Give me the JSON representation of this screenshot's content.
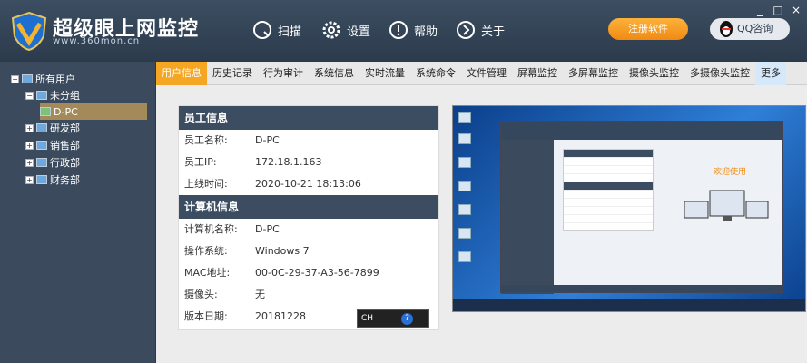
{
  "app": {
    "brand": "超级眼上网监控",
    "url": "www.360mon.cn",
    "nav": [
      {
        "label": "扫描",
        "icon": "search-icon"
      },
      {
        "label": "设置",
        "icon": "gear-icon"
      },
      {
        "label": "帮助",
        "icon": "help-icon"
      },
      {
        "label": "关于",
        "icon": "chevron-right-icon"
      }
    ],
    "register_label": "注册软件",
    "qq_label": "QQ咨询",
    "window_controls": [
      "_",
      "□",
      "×"
    ]
  },
  "sidebar": {
    "items": [
      {
        "label": "所有用户",
        "level": 0
      },
      {
        "label": "未分组",
        "level": 1
      },
      {
        "label": "D-PC",
        "level": 2,
        "selected": true
      },
      {
        "label": "研发部",
        "level": 1
      },
      {
        "label": "销售部",
        "level": 1
      },
      {
        "label": "行政部",
        "level": 1
      },
      {
        "label": "财务部",
        "level": 1
      }
    ]
  },
  "tabs": [
    {
      "label": "用户信息",
      "active": true
    },
    {
      "label": "历史记录"
    },
    {
      "label": "行为审计"
    },
    {
      "label": "系统信息"
    },
    {
      "label": "实时流量"
    },
    {
      "label": "系统命令"
    },
    {
      "label": "文件管理"
    },
    {
      "label": "屏幕监控"
    },
    {
      "label": "多屏幕监控"
    },
    {
      "label": "摄像头监控"
    },
    {
      "label": "多摄像头监控"
    },
    {
      "label": "更多"
    }
  ],
  "employee": {
    "title": "员工信息",
    "rows": [
      {
        "label": "员工名称:",
        "value": "D-PC"
      },
      {
        "label": "员工IP:",
        "value": "172.18.1.163"
      },
      {
        "label": "上线时间:",
        "value": "2020-10-21 18:13:06"
      }
    ]
  },
  "computer": {
    "title": "计算机信息",
    "rows": [
      {
        "label": "计算机名称:",
        "value": "D-PC"
      },
      {
        "label": "操作系统:",
        "value": "Windows 7"
      },
      {
        "label": "MAC地址:",
        "value": "00-0C-29-37-A3-56-7899"
      },
      {
        "label": "摄像头:",
        "value": "无"
      },
      {
        "label": "版本日期:",
        "value": "20181228"
      }
    ]
  },
  "lang_bar": {
    "text": "CH",
    "help": "?"
  },
  "preview": {
    "welcome": "欢迎使用"
  },
  "colors": {
    "accent": "#f5a623",
    "header": "#34475c",
    "selected": "#a48a58"
  }
}
